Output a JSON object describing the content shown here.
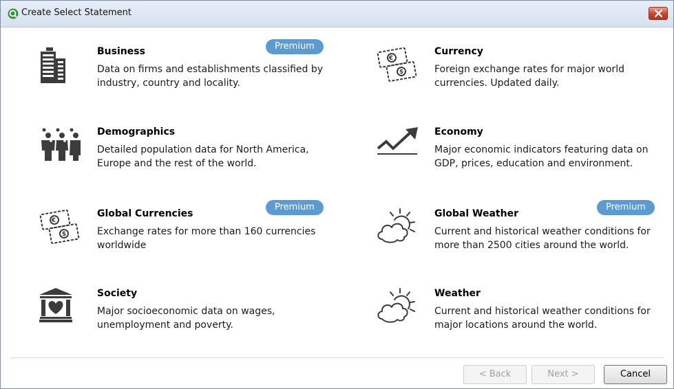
{
  "window": {
    "title": "Create Select Statement"
  },
  "datasets": [
    {
      "name": "Business",
      "description": "Data on firms and establishments classified by industry, country and locality.",
      "badge": "Premium",
      "icon": "building-icon"
    },
    {
      "name": "Currency",
      "description": "Foreign exchange rates for major world currencies. Updated daily.",
      "badge": "",
      "icon": "banknotes-icon"
    },
    {
      "name": "Demographics",
      "description": "Detailed population data for North America, Europe and the rest of the world.",
      "badge": "",
      "icon": "people-icon"
    },
    {
      "name": "Economy",
      "description": "Major economic indicators featuring data on GDP, prices, education and environment.",
      "badge": "",
      "icon": "trend-up-icon"
    },
    {
      "name": "Global Currencies",
      "description": "Exchange rates for more than 160 currencies worldwide",
      "badge": "Premium",
      "icon": "banknotes-icon"
    },
    {
      "name": "Global Weather",
      "description": "Current and historical weather conditions for more than 2500 cities around the world.",
      "badge": "Premium",
      "icon": "sun-cloud-icon"
    },
    {
      "name": "Society",
      "description": "Major socioeconomic data on wages, unemployment and poverty.",
      "badge": "",
      "icon": "institution-heart-icon"
    },
    {
      "name": "Weather",
      "description": "Current and historical weather conditions for major locations around the world.",
      "badge": "",
      "icon": "sun-cloud-icon"
    }
  ],
  "footer": {
    "back_label": "< Back",
    "next_label": "Next >",
    "cancel_label": "Cancel"
  },
  "colors": {
    "badge": "#5b9bd1",
    "icon": "#3c3c3c",
    "close_button": "#c5452a"
  }
}
